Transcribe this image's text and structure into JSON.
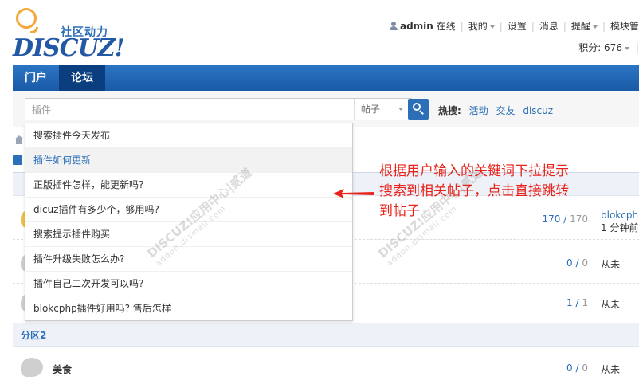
{
  "header": {
    "logo_slogan": "社区动力",
    "logo_word": "DISCUZ!",
    "user": "admin",
    "online_status": "在线",
    "menu": [
      "我的",
      "设置",
      "消息",
      "提醒",
      "模块管"
    ],
    "credits_label": "积分: 676"
  },
  "nav": {
    "items": [
      {
        "label": "门户",
        "active": false
      },
      {
        "label": "论坛",
        "active": true
      }
    ]
  },
  "search": {
    "value": "插件",
    "type_label": "帖子",
    "hot_label": "热搜:",
    "hot_words": [
      "活动",
      "交友",
      "discuz"
    ]
  },
  "suggestions": [
    "搜索插件今天发布",
    "插件如何更新",
    "正版插件怎样，能更新吗?",
    "dicuz插件有多少个，够用吗?",
    "搜索提示插件购买",
    "插件升级失败怎么办?",
    "插件自己二次开发可以吗?",
    "blokcphp插件好用吗? 售后怎样"
  ],
  "forum": {
    "category_2": "分区2",
    "rows": [
      {
        "name": "",
        "count": "170",
        "total": "170",
        "last_line1": "blokcphp",
        "last_line2": "1 分钟前"
      },
      {
        "name": "",
        "count": "0",
        "total": "0",
        "last": "从未"
      },
      {
        "name": "",
        "count": "1",
        "total": "1",
        "last": "从未"
      },
      {
        "name": "美食",
        "count": "0",
        "total": "0",
        "last": "从未"
      }
    ]
  },
  "watermark": {
    "text": "DISCUZ!应用中心|贰道",
    "url": "addon.dismall.com"
  },
  "annotation": {
    "line1": "根据用户输入的关键词下拉提示",
    "line2": "搜索到相关帖子，点击直接跳转",
    "line3": "到帖子"
  },
  "colors": {
    "nav_blue": "#1a5aa6",
    "link_blue": "#2a6fb8",
    "annotation_red": "#e8231b"
  }
}
